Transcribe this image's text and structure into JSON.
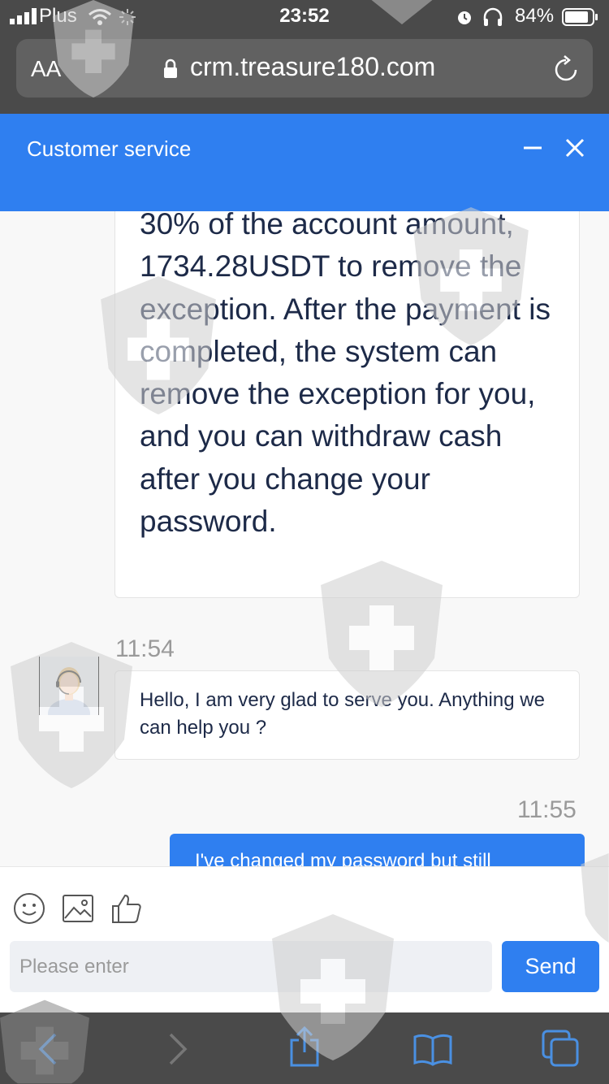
{
  "status_bar": {
    "carrier": "Plus",
    "time": "23:52",
    "battery": "84%"
  },
  "browser": {
    "text_size_label": "AA",
    "url": "crm.treasure180.com"
  },
  "header": {
    "title": "Customer service"
  },
  "messages": {
    "partial_text": "30% of the account amount, 1734.28USDT to remove the exception. After the payment is completed, the system can remove the exception for you, and you can withdraw cash after you change your password.",
    "time_1": "11:54",
    "agent_greeting": "Hello, I am very glad to serve you. Anything we can help you ?",
    "time_2": "11:55",
    "user_message_partial": "I've changed my password but still"
  },
  "composer": {
    "placeholder": "Please enter",
    "send_label": "Send"
  },
  "colors": {
    "accent": "#2f7ff0",
    "browser_chrome": "#4a4a4a",
    "chat_background": "#f8f8f8",
    "message_text": "#1d2a48"
  },
  "icons": [
    "signal-icon",
    "wifi-icon",
    "alarm-icon",
    "headphones-icon",
    "battery-icon",
    "lock-icon",
    "reload-icon",
    "minimize-icon",
    "close-icon",
    "emoji-icon",
    "image-icon",
    "thumbs-up-icon",
    "back-icon",
    "forward-icon",
    "share-icon",
    "bookmarks-icon",
    "tabs-icon"
  ]
}
